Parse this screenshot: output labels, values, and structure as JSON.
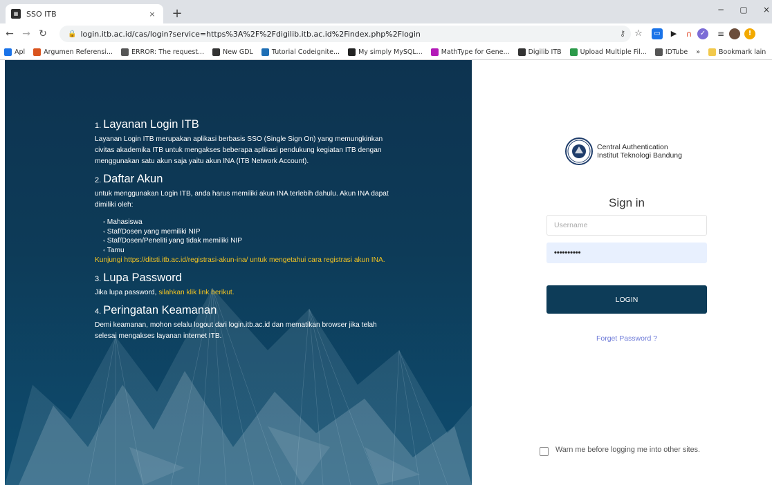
{
  "browser": {
    "tab_title": "SSO ITB",
    "tab_close": "×",
    "new_tab": "+",
    "url": "login.itb.ac.id/cas/login?service=https%3A%2F%2Fdigilib.itb.ac.id%2Findex.php%2Flogin",
    "win_minimize": "−",
    "win_restore": "▢",
    "win_close": "×",
    "bookmarks": [
      {
        "label": "Apl",
        "icon": "apps-grid-icon",
        "color": "#1a73e8"
      },
      {
        "label": "Argumen Referensi...",
        "icon": "argumen-icon",
        "color": "#d9541e"
      },
      {
        "label": "ERROR: The request...",
        "icon": "globe-icon",
        "color": "#555555"
      },
      {
        "label": "New GDL",
        "icon": "itb-icon",
        "color": "#333333"
      },
      {
        "label": "Tutorial Codeignite...",
        "icon": "codeigniter-icon",
        "color": "#1f6fb5"
      },
      {
        "label": "My simply MySQL...",
        "icon": "github-icon",
        "color": "#222222"
      },
      {
        "label": "MathType for Gene...",
        "icon": "mathtype-icon",
        "color": "#b31bb8"
      },
      {
        "label": "Digilib ITB",
        "icon": "itb-icon",
        "color": "#333333"
      },
      {
        "label": "Upload Multiple Fil...",
        "icon": "cv-icon",
        "color": "#2c9a4a"
      },
      {
        "label": "IDTube",
        "icon": "globe-icon",
        "color": "#555555"
      }
    ],
    "bookmarks_more": "»",
    "bookmarks_other": "Bookmark lain"
  },
  "info": {
    "s1": {
      "num": "1.",
      "title": "Layanan Login ITB",
      "text": "Layanan Login ITB merupakan aplikasi berbasis SSO (Single Sign On) yang memungkinkan civitas akademika ITB untuk mengakses beberapa aplikasi pendukung kegiatan ITB dengan menggunakan satu akun saja yaitu akun INA (ITB Network Account)."
    },
    "s2": {
      "num": "2.",
      "title": "Daftar Akun",
      "text": "untuk menggunakan Login ITB, anda harus memiliki akun INA terlebih dahulu. Akun INA dapat dimiliki oleh:",
      "items": [
        "Mahasiswa",
        "Staf/Dosen yang memiliki NIP",
        "Staf/Dosen/Peneliti yang tidak memiliki NIP",
        "Tamu"
      ],
      "link_text": "Kunjungi https://ditsti.itb.ac.id/registrasi-akun-ina/ untuk mengetahui cara registrasi akun INA."
    },
    "s3": {
      "num": "3.",
      "title": "Lupa Password",
      "text": "Jika lupa password, ",
      "link": "silahkan klik link berikut."
    },
    "s4": {
      "num": "4.",
      "title": "Peringatan Keamanan",
      "text": "Demi keamanan, mohon selalu logout dari login.itb.ac.id dan mematikan browser jika telah selesai mengakses layanan internet ITB."
    }
  },
  "login": {
    "brand_line1": "Central Authentication",
    "brand_line2": "Institut Teknologi Bandung",
    "signin": "Sign in",
    "username_placeholder": "Username",
    "password_value": "••••••••••",
    "button": "LOGIN",
    "forget": "Forget Password ?",
    "warn": "Warn me before logging me into other sites."
  },
  "colors": {
    "panel": "#0d3b58",
    "accent_yellow": "#f2c322",
    "button": "#0d3c58",
    "link_blue": "#6e7bd8"
  }
}
